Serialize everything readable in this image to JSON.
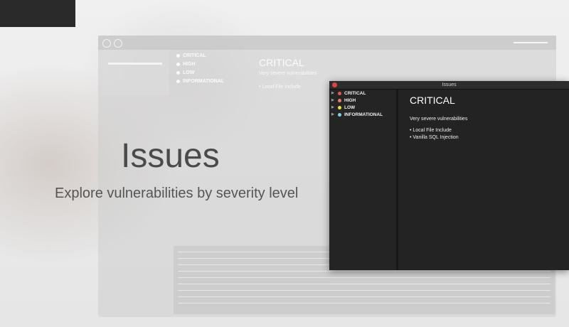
{
  "hero": {
    "title": "Issues",
    "subtitle": "Explore vulnerabilities by severity level"
  },
  "background_window": {
    "severities": [
      "CRITICAL",
      "HIGH",
      "LOW",
      "INFORMATIONAL"
    ],
    "content_title": "CRITICAL",
    "content_subtitle": "Very severe vulnerabilities",
    "first_item": "• Local File Include"
  },
  "window": {
    "title": "Issues",
    "close_color": "#e0443e",
    "severities": [
      {
        "label": "CRITICAL",
        "color": "#e05a4e"
      },
      {
        "label": "HIGH",
        "color": "#e87e6a"
      },
      {
        "label": "LOW",
        "color": "#e6e23a"
      },
      {
        "label": "INFORMATIONAL",
        "color": "#7fd3df"
      }
    ],
    "content": {
      "title": "CRITICAL",
      "subtitle": "Very severe vulnerabilities",
      "items": [
        "• Local File Include",
        "• Vanilla SQL Injection"
      ]
    }
  }
}
